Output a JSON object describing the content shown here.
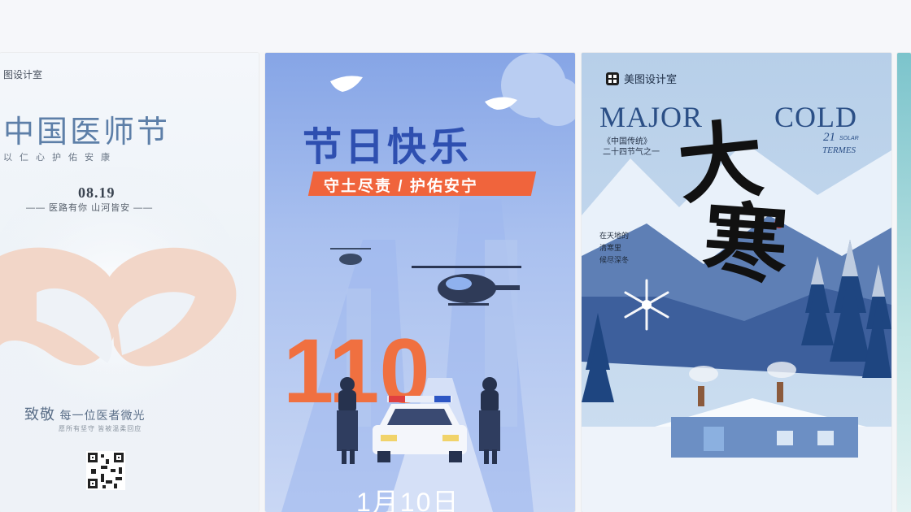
{
  "cards": [
    {
      "brand": "图设计室",
      "title": "中国医师节",
      "subtitle": "以仁心护佑安康",
      "date": "08.19",
      "motto": "—— 医路有你 山河皆安 ——",
      "salute_big": "致敬",
      "salute_small": "每一位医者微光",
      "small_line": "愿所有坚守 皆被温柔回应"
    },
    {
      "title": "节日快乐",
      "banner": "守土尽责 / 护佑安宁",
      "number": "110",
      "date": "1月10日"
    },
    {
      "brand": "美图设计室",
      "major": "MAJOR",
      "cold": "COLD",
      "traditional_1": "《中国传统》",
      "traditional_2": "二十四节气之一",
      "number": "21",
      "solar": "SOLAR",
      "termes": "TERMES",
      "line_1": "在天地的",
      "line_2": "清寒里",
      "line_3": "候尽深冬",
      "big_1": "大",
      "big_2": "寒"
    }
  ]
}
